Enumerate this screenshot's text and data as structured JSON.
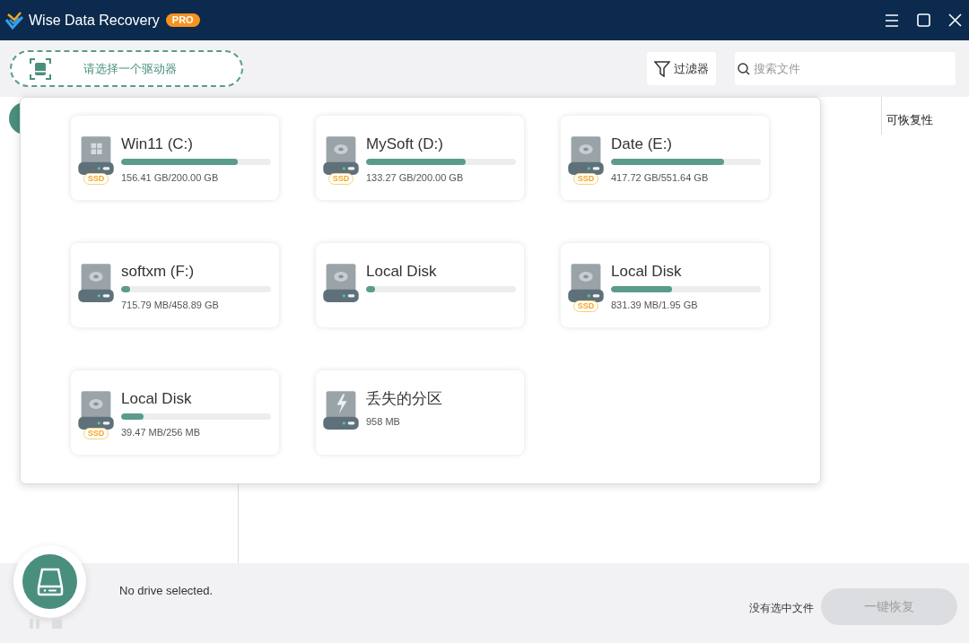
{
  "window": {
    "title": "Wise Data Recovery",
    "badge": "PRO"
  },
  "toolbar": {
    "drive_selector": "请选择一个驱动器",
    "filter_button": "过滤器",
    "search": {
      "placeholder": "搜索文件"
    }
  },
  "table": {
    "columns": [
      "可恢复性"
    ]
  },
  "drive_list": [
    {
      "name": "Win11 (C:)",
      "kind": "windows",
      "usage": "156.41 GB/200.00 GB",
      "level": 0.78,
      "badge": "SSD"
    },
    {
      "name": "MySoft (D:)",
      "kind": "disk",
      "usage": "133.27 GB/200.00 GB",
      "level": 0.665,
      "badge": "SSD"
    },
    {
      "name": "Date (E:)",
      "kind": "disk",
      "usage": "417.72 GB/551.64 GB",
      "level": 0.757,
      "badge": "SSD"
    },
    {
      "name": "softxm (F:)",
      "kind": "disk",
      "usage": "715.79 MB/458.89 GB",
      "level": 0.06
    },
    {
      "name": "Local Disk",
      "kind": "disk",
      "level": 0.06
    },
    {
      "name": "Local Disk",
      "kind": "disk",
      "usage": "831.39 MB/1.95 GB",
      "level": 0.41,
      "badge": "SSD"
    },
    {
      "name": "Local Disk",
      "kind": "disk",
      "usage": "39.47 MB/256 MB",
      "level": 0.15,
      "badge": "SSD"
    },
    {
      "name": "丢失的分区",
      "kind": "lost",
      "usage": "958 MB"
    }
  ],
  "status_bar": {
    "message": "No drive selected.",
    "selection": "没有选中文件",
    "recover_button": {
      "label": "一键恢复",
      "disabled": true
    }
  }
}
